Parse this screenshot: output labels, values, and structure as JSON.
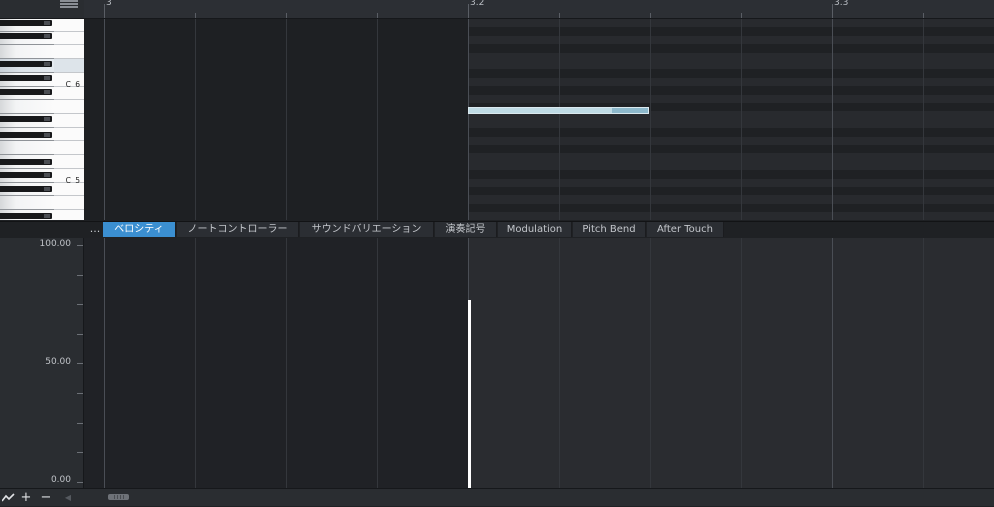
{
  "ruler": {
    "markers": [
      {
        "label": "3",
        "pos": 104
      },
      {
        "label": "3.2",
        "pos": 468
      },
      {
        "label": "3.3",
        "pos": 832
      }
    ]
  },
  "keyboard": {
    "labels": {
      "c6": "C 6",
      "c5": "C 5"
    }
  },
  "controller_tabs": {
    "more": "...",
    "items": [
      "ベロシティ",
      "ノートコントローラー",
      "サウンドバリエーション",
      "演奏記号",
      "Modulation",
      "Pitch Bend",
      "After Touch"
    ],
    "active_index": 0
  },
  "velocity_lane": {
    "scale_labels": [
      "100.00",
      "50.00",
      "0.00"
    ],
    "note_velocity": 0.79
  },
  "icons": {
    "menu": "hamburger-menu-icon",
    "automation": "automation-line-icon",
    "add": "plus-icon",
    "remove": "minus-icon",
    "scroll_left": "triangle-left-icon"
  },
  "colors": {
    "active_tab": "#3b8fd1",
    "note_fill": "#bfdbe5",
    "velocity_bar": "#ffffff"
  },
  "bottom_toolbar": {
    "add": "+",
    "remove": "−",
    "scroll_left": "◀"
  }
}
